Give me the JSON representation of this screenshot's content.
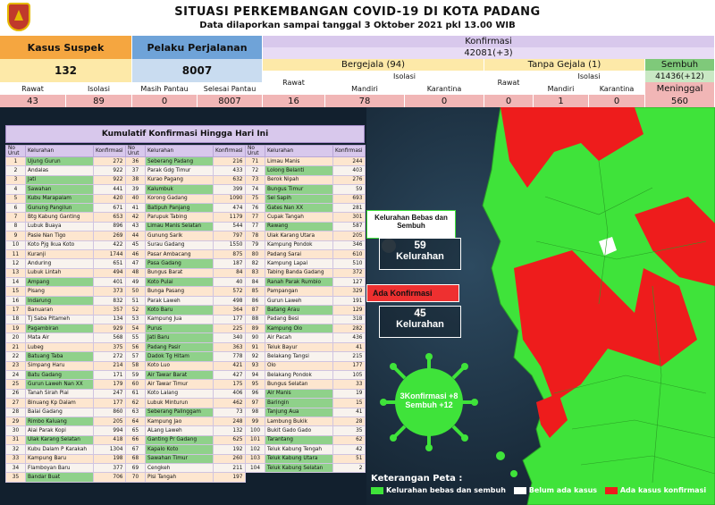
{
  "header": {
    "title": "SITUASI PERKEMBANGAN COVID-19 DI KOTA PADANG",
    "subtitle": "Data dilaporkan sampai tanggal  3 Oktober 2021 pkl 13.00 WIB"
  },
  "stats": {
    "suspek_label": "Kasus Suspek",
    "suspek_value": "132",
    "rawat_label": "Rawat",
    "rawat_value": "43",
    "isolasi_label": "Isolasi",
    "isolasi_value": "89",
    "pelaku_label": "Pelaku Perjalanan",
    "pelaku_value": "8007",
    "masih_pantau_label": "Masih Pantau",
    "masih_pantau_value": "0",
    "selesai_pantau_label": "Selesai Pantau",
    "selesai_pantau_value": "8007",
    "konfirmasi_label": "Konfirmasi",
    "konfirmasi_value": "42081(+3)",
    "bergejala_label": "Bergejala (94)",
    "tanpa_gejala_label": "Tanpa Gejala (1)",
    "sembuh_label": "Sembuh",
    "sembuh_value": "41436(+12)",
    "meninggal_label": "Meninggal",
    "meninggal_value": "560",
    "bg_rawat_label": "Rawat",
    "bg_rawat_value": "16",
    "bg_isolasi_label": "Isolasi",
    "bg_mandiri_label": "Mandiri",
    "bg_mandiri_value": "78",
    "bg_karantina_label": "Karantina",
    "bg_karantina_value": "0",
    "tg_rawat_label": "Rawat",
    "tg_rawat_value": "0",
    "tg_isolasi_label": "Isolasi",
    "tg_mandiri_label": "Mandiri",
    "tg_mandiri_value": "1",
    "tg_karantina_label": "Karantina",
    "tg_karantina_value": "0"
  },
  "table": {
    "title": "Kumulatif Konfirmasi Hingga Hari Ini",
    "headers": [
      "No Urut",
      "Kelurahan",
      "Konfirmasi"
    ],
    "col1": [
      [
        "1",
        "Ujung Gurun",
        "272",
        1
      ],
      [
        "2",
        "Andalas",
        "922",
        0
      ],
      [
        "3",
        "Jati",
        "922",
        1
      ],
      [
        "4",
        "Sawahan",
        "441",
        1
      ],
      [
        "5",
        "Kubu Marapalam",
        "420",
        1
      ],
      [
        "6",
        "Gunung Pangilun",
        "671",
        1
      ],
      [
        "7",
        "Btg Kabung Ganting",
        "653",
        0
      ],
      [
        "8",
        "Lubuk Buaya",
        "896",
        0
      ],
      [
        "9",
        "Pasie Nan Tigo",
        "269",
        0
      ],
      [
        "10",
        "Koto Pjg Ikua Koto",
        "422",
        0
      ],
      [
        "11",
        "Kuranji",
        "1744",
        0
      ],
      [
        "12",
        "Anduring",
        "651",
        0
      ],
      [
        "13",
        "Lubuk Lintah",
        "494",
        0
      ],
      [
        "14",
        "Ampang",
        "401",
        1
      ],
      [
        "15",
        "Pisang",
        "373",
        0
      ],
      [
        "16",
        "Indarung",
        "832",
        1
      ],
      [
        "17",
        "Banuaran",
        "357",
        0
      ],
      [
        "18",
        "Tj Saba Pitameh",
        "134",
        0
      ],
      [
        "19",
        "Pagambiran",
        "929",
        1
      ],
      [
        "20",
        "Mata Air",
        "568",
        0
      ],
      [
        "21",
        "Lubeg",
        "375",
        0
      ],
      [
        "22",
        "Batuang Taba",
        "272",
        1
      ],
      [
        "23",
        "Simpang Haru",
        "214",
        0
      ],
      [
        "24",
        "Batu Gadang",
        "171",
        1
      ],
      [
        "25",
        "Gurun Laweh Nan XX",
        "179",
        1
      ],
      [
        "26",
        "Tanah Sirah Piai",
        "247",
        0
      ],
      [
        "27",
        "Binuang Kp Dalam",
        "177",
        0
      ],
      [
        "28",
        "Balai Gadang",
        "860",
        0
      ],
      [
        "29",
        "Rimbo Kaluang",
        "205",
        1
      ],
      [
        "30",
        "Alai Parak Kopi",
        "994",
        0
      ],
      [
        "31",
        "Ulak Karang Selatan",
        "418",
        1
      ],
      [
        "32",
        "Kubu Dalam P Karakah",
        "1304",
        0
      ],
      [
        "33",
        "Kampung Baru",
        "198",
        0
      ],
      [
        "34",
        "Flamboyan Baru",
        "377",
        0
      ],
      [
        "35",
        "Bandar Buat",
        "706",
        1
      ]
    ],
    "col2": [
      [
        "36",
        "Seberang Padang",
        "216",
        1
      ],
      [
        "37",
        "Parak Gdg Timur",
        "433",
        0
      ],
      [
        "38",
        "Kurao Pagang",
        "632",
        0
      ],
      [
        "39",
        "Kalumbuk",
        "399",
        1
      ],
      [
        "40",
        "Korong Gadang",
        "1090",
        0
      ],
      [
        "41",
        "Batipuh Panjang",
        "474",
        1
      ],
      [
        "42",
        "Parupuk Tabing",
        "1179",
        0
      ],
      [
        "43",
        "Limau Manis Selatan",
        "544",
        1
      ],
      [
        "44",
        "Gunung Sarik",
        "797",
        0
      ],
      [
        "45",
        "Surau Gadang",
        "1550",
        0
      ],
      [
        "46",
        "Pasar Ambacang",
        "875",
        0
      ],
      [
        "47",
        "Pasa Gadang",
        "187",
        1
      ],
      [
        "48",
        "Bungus Barat",
        "84",
        0
      ],
      [
        "49",
        "Koto Pulai",
        "40",
        1
      ],
      [
        "50",
        "Bunga Pasang",
        "572",
        0
      ],
      [
        "51",
        "Parak Laweh",
        "498",
        0
      ],
      [
        "52",
        "Koto Baru",
        "364",
        1
      ],
      [
        "53",
        "Kampung Jua",
        "177",
        0
      ],
      [
        "54",
        "Purus",
        "225",
        1
      ],
      [
        "55",
        "Jati Baru",
        "340",
        1
      ],
      [
        "56",
        "Padang Pasir",
        "363",
        1
      ],
      [
        "57",
        "Dadok Tg Hitam",
        "778",
        1
      ],
      [
        "58",
        "Koto Luo",
        "421",
        0
      ],
      [
        "59",
        "Air Tawar Barat",
        "427",
        1
      ],
      [
        "60",
        "Air Tawar Timur",
        "175",
        0
      ],
      [
        "61",
        "Koto Lalang",
        "406",
        0
      ],
      [
        "62",
        "Lubuk Minturun",
        "462",
        0
      ],
      [
        "63",
        "Seberang Palinggam",
        "73",
        1
      ],
      [
        "64",
        "Kampung Jao",
        "248",
        0
      ],
      [
        "65",
        "ALang Laweh",
        "132",
        0
      ],
      [
        "66",
        "Ganting Pr Gadang",
        "625",
        1
      ],
      [
        "67",
        "Kapalo Koto",
        "192",
        1
      ],
      [
        "68",
        "Sawahan Timur",
        "260",
        1
      ],
      [
        "69",
        "Cengkeh",
        "211",
        0
      ],
      [
        "70",
        "Pisi Tangah",
        "197",
        0
      ]
    ],
    "col3": [
      [
        "71",
        "Limau Manis",
        "244",
        0
      ],
      [
        "72",
        "Lolong Belanti",
        "403",
        1
      ],
      [
        "73",
        "Berok Nipah",
        "276",
        0
      ],
      [
        "74",
        "Bungus Timur",
        "59",
        1
      ],
      [
        "75",
        "Sei Sapih",
        "693",
        1
      ],
      [
        "76",
        "Gates Nan XX",
        "281",
        1
      ],
      [
        "77",
        "Cupak Tangah",
        "301",
        0
      ],
      [
        "77",
        "Rawang",
        "587",
        1
      ],
      [
        "78",
        "Ulak Karang Utara",
        "205",
        0
      ],
      [
        "79",
        "Kampung Pondok",
        "346",
        0
      ],
      [
        "80",
        "Padang Sarai",
        "610",
        0
      ],
      [
        "82",
        "Kampung Lapai",
        "510",
        0
      ],
      [
        "83",
        "Tabing Banda Gadang",
        "372",
        0
      ],
      [
        "84",
        "Ranah Parak Rumbio",
        "127",
        1
      ],
      [
        "85",
        "Pampangan",
        "329",
        0
      ],
      [
        "86",
        "Gurun Laweh",
        "191",
        0
      ],
      [
        "87",
        "Batang Arau",
        "129",
        1
      ],
      [
        "88",
        "Padang Besi",
        "318",
        0
      ],
      [
        "89",
        "Kampung Olo",
        "282",
        1
      ],
      [
        "90",
        "Air Pacah",
        "436",
        0
      ],
      [
        "91",
        "Teluk Bayur",
        "41",
        0
      ],
      [
        "92",
        "Belakang Tangsi",
        "215",
        0
      ],
      [
        "93",
        "Olo",
        "177",
        0
      ],
      [
        "94",
        "Belakang Pondok",
        "105",
        0
      ],
      [
        "95",
        "Bungus Selatan",
        "33",
        0
      ],
      [
        "96",
        "Air Manis",
        "19",
        1
      ],
      [
        "97",
        "Baringin",
        "15",
        1
      ],
      [
        "98",
        "Tanjung Aua",
        "41",
        1
      ],
      [
        "99",
        "Lambung Bukik",
        "28",
        0
      ],
      [
        "100",
        "Bukit Gado Gado",
        "35",
        0
      ],
      [
        "101",
        "Tarantang",
        "62",
        1
      ],
      [
        "102",
        "Teluk Kabung Tengah",
        "42",
        0
      ],
      [
        "103",
        "Teluk Kabung Utara",
        "51",
        1
      ],
      [
        "104",
        "Teluk Kabung Selatan",
        "2",
        1
      ]
    ]
  },
  "map": {
    "bebas_title": "Kelurahan Bebas dan Sembuh",
    "bebas_value": "59",
    "bebas_unit": "Kelurahan",
    "ada_title": "Ada Konfirmasi",
    "ada_value": "45",
    "ada_unit": "Kelurahan",
    "virus_line1": "3Konfirmasi +8",
    "virus_line2": "Sembuh +12",
    "legend_title": "Keterangan Peta :",
    "legend_green": "Kelurahan bebas dan sembuh",
    "legend_white": "Belum ada kasus",
    "legend_red": "Ada kasus konfirmasi",
    "colors": {
      "green": "#3fe33a",
      "red": "#ee1c1c",
      "white": "#ffffff"
    }
  }
}
